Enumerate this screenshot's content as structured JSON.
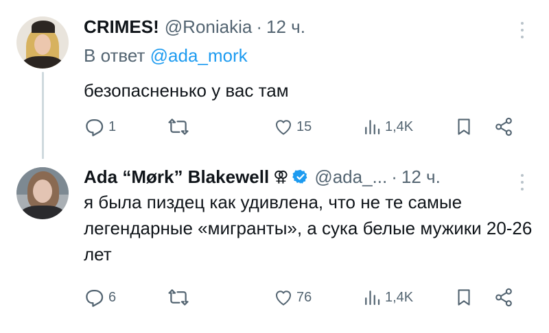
{
  "tweets": [
    {
      "display_name": "CRIMES!",
      "handle": "@Roniakia",
      "separator": "·",
      "time": "12 ч.",
      "reply_prefix": "В ответ",
      "reply_mention": "@ada_mork",
      "text": "безопасненько у вас там",
      "stats": {
        "replies": "1",
        "likes": "15",
        "views": "1,4K"
      },
      "icons": [
        "reply-icon",
        "retweet-icon",
        "like-icon",
        "views-icon",
        "bookmark-icon",
        "share-icon"
      ]
    },
    {
      "display_name": "Ada “Mørk” Blakewell",
      "badge_glyph": "⚢",
      "handle": "@ada_...",
      "separator": "·",
      "time": "12 ч.",
      "text": "я была пиздец как удивлена, что не те самые легендарные «мигранты», а сука белые мужики 20-26 лет",
      "stats": {
        "replies": "6",
        "likes": "76",
        "views": "1,4K"
      },
      "icons": [
        "reply-icon",
        "retweet-icon",
        "like-icon",
        "views-icon",
        "bookmark-icon",
        "share-icon"
      ]
    }
  ],
  "colors": {
    "text": "#0f1419",
    "secondary": "#536471",
    "link": "#1d9bf0",
    "verified": "#1d9bf0",
    "thread_line": "#cfd9de"
  }
}
